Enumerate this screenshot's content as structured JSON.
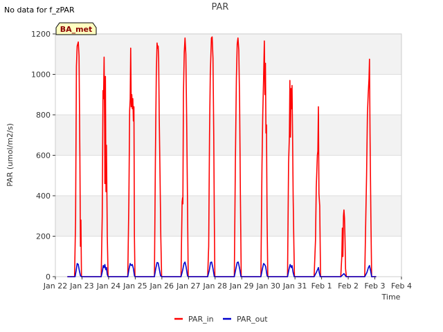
{
  "chart_data": {
    "type": "line",
    "title": "PAR",
    "note": "No data for f_zPAR",
    "badge": "BA_met",
    "xlabel": "Time",
    "ylabel": "PAR (umol/m2/s)",
    "xlim": [
      0,
      13
    ],
    "ylim": [
      0,
      1200
    ],
    "x_tick_labels": [
      "Jan 22",
      "Jan 23",
      "Jan 24",
      "Jan 25",
      "Jan 26",
      "Jan 27",
      "Jan 28",
      "Jan 29",
      "Jan 30",
      "Jan 31",
      "Feb 1",
      "Feb 2",
      "Feb 3",
      "Feb 4"
    ],
    "y_ticks": [
      0,
      200,
      400,
      600,
      800,
      1000,
      1200
    ],
    "x_unit_note": "x values are days, with day 0 = Jan 22 00:00",
    "grid": true,
    "legend_position": "bottom",
    "series": [
      {
        "name": "PAR_in",
        "color": "#ff0000",
        "points": [
          [
            0.45,
            0
          ],
          [
            0.72,
            0
          ],
          [
            0.76,
            280
          ],
          [
            0.79,
            1040
          ],
          [
            0.82,
            1140
          ],
          [
            0.86,
            1160
          ],
          [
            0.89,
            1090
          ],
          [
            0.92,
            600
          ],
          [
            0.94,
            150
          ],
          [
            0.96,
            280
          ],
          [
            0.98,
            0
          ],
          [
            1.72,
            0
          ],
          [
            1.76,
            300
          ],
          [
            1.79,
            920
          ],
          [
            1.81,
            880
          ],
          [
            1.83,
            1085
          ],
          [
            1.85,
            740
          ],
          [
            1.86,
            460
          ],
          [
            1.88,
            990
          ],
          [
            1.9,
            420
          ],
          [
            1.92,
            650
          ],
          [
            1.95,
            200
          ],
          [
            1.98,
            0
          ],
          [
            2.72,
            0
          ],
          [
            2.76,
            380
          ],
          [
            2.79,
            820
          ],
          [
            2.81,
            880
          ],
          [
            2.83,
            1130
          ],
          [
            2.85,
            840
          ],
          [
            2.87,
            900
          ],
          [
            2.89,
            830
          ],
          [
            2.91,
            880
          ],
          [
            2.93,
            770
          ],
          [
            2.95,
            840
          ],
          [
            2.97,
            200
          ],
          [
            2.99,
            0
          ],
          [
            3.72,
            0
          ],
          [
            3.76,
            620
          ],
          [
            3.79,
            1000
          ],
          [
            3.82,
            1155
          ],
          [
            3.84,
            1130
          ],
          [
            3.86,
            1140
          ],
          [
            3.88,
            1080
          ],
          [
            3.9,
            800
          ],
          [
            3.93,
            500
          ],
          [
            3.96,
            200
          ],
          [
            3.99,
            0
          ],
          [
            4.72,
            0
          ],
          [
            4.76,
            370
          ],
          [
            4.78,
            390
          ],
          [
            4.79,
            360
          ],
          [
            4.81,
            900
          ],
          [
            4.84,
            1110
          ],
          [
            4.87,
            1180
          ],
          [
            4.9,
            1100
          ],
          [
            4.93,
            800
          ],
          [
            4.96,
            400
          ],
          [
            4.99,
            0
          ],
          [
            5.72,
            0
          ],
          [
            5.76,
            150
          ],
          [
            5.79,
            700
          ],
          [
            5.82,
            1000
          ],
          [
            5.86,
            1180
          ],
          [
            5.89,
            1185
          ],
          [
            5.92,
            1080
          ],
          [
            5.95,
            700
          ],
          [
            5.97,
            300
          ],
          [
            5.99,
            0
          ],
          [
            6.72,
            0
          ],
          [
            6.76,
            550
          ],
          [
            6.8,
            980
          ],
          [
            6.83,
            1150
          ],
          [
            6.86,
            1180
          ],
          [
            6.89,
            1120
          ],
          [
            6.92,
            850
          ],
          [
            6.95,
            400
          ],
          [
            6.98,
            0
          ],
          [
            7.72,
            0
          ],
          [
            7.76,
            550
          ],
          [
            7.79,
            800
          ],
          [
            7.82,
            980
          ],
          [
            7.85,
            1165
          ],
          [
            7.87,
            900
          ],
          [
            7.89,
            1055
          ],
          [
            7.91,
            710
          ],
          [
            7.93,
            750
          ],
          [
            7.95,
            300
          ],
          [
            7.98,
            0
          ],
          [
            8.72,
            0
          ],
          [
            8.76,
            560
          ],
          [
            8.79,
            700
          ],
          [
            8.81,
            970
          ],
          [
            8.83,
            690
          ],
          [
            8.85,
            930
          ],
          [
            8.87,
            830
          ],
          [
            8.89,
            945
          ],
          [
            8.91,
            700
          ],
          [
            8.93,
            400
          ],
          [
            8.96,
            150
          ],
          [
            8.98,
            0
          ],
          [
            9.72,
            0
          ],
          [
            9.77,
            180
          ],
          [
            9.8,
            440
          ],
          [
            9.84,
            600
          ],
          [
            9.86,
            620
          ],
          [
            9.88,
            840
          ],
          [
            9.9,
            410
          ],
          [
            9.93,
            350
          ],
          [
            9.96,
            0
          ],
          [
            10.72,
            0
          ],
          [
            10.76,
            100
          ],
          [
            10.78,
            240
          ],
          [
            10.8,
            100
          ],
          [
            10.82,
            300
          ],
          [
            10.84,
            330
          ],
          [
            10.86,
            290
          ],
          [
            10.88,
            180
          ],
          [
            10.9,
            40
          ],
          [
            10.93,
            0
          ],
          [
            11.62,
            0
          ],
          [
            11.66,
            300
          ],
          [
            11.69,
            500
          ],
          [
            11.72,
            800
          ],
          [
            11.75,
            900
          ],
          [
            11.78,
            980
          ],
          [
            11.8,
            1075
          ],
          [
            11.82,
            700
          ],
          [
            11.85,
            300
          ],
          [
            11.88,
            0
          ],
          [
            12.05,
            0
          ]
        ]
      },
      {
        "name": "PAR_out",
        "color": "#0000cc",
        "points": [
          [
            0.45,
            0
          ],
          [
            0.74,
            0
          ],
          [
            0.78,
            30
          ],
          [
            0.82,
            65
          ],
          [
            0.86,
            60
          ],
          [
            0.9,
            30
          ],
          [
            0.94,
            5
          ],
          [
            0.98,
            0
          ],
          [
            1.72,
            0
          ],
          [
            1.77,
            30
          ],
          [
            1.8,
            55
          ],
          [
            1.83,
            45
          ],
          [
            1.86,
            60
          ],
          [
            1.89,
            35
          ],
          [
            1.92,
            45
          ],
          [
            1.95,
            10
          ],
          [
            1.98,
            0
          ],
          [
            2.72,
            0
          ],
          [
            2.77,
            40
          ],
          [
            2.81,
            65
          ],
          [
            2.85,
            55
          ],
          [
            2.89,
            60
          ],
          [
            2.93,
            40
          ],
          [
            2.97,
            5
          ],
          [
            2.99,
            0
          ],
          [
            3.72,
            0
          ],
          [
            3.77,
            40
          ],
          [
            3.82,
            70
          ],
          [
            3.86,
            68
          ],
          [
            3.9,
            40
          ],
          [
            3.95,
            5
          ],
          [
            3.99,
            0
          ],
          [
            4.72,
            0
          ],
          [
            4.78,
            30
          ],
          [
            4.83,
            65
          ],
          [
            4.87,
            72
          ],
          [
            4.91,
            50
          ],
          [
            4.96,
            5
          ],
          [
            4.99,
            0
          ],
          [
            5.72,
            0
          ],
          [
            5.78,
            30
          ],
          [
            5.83,
            70
          ],
          [
            5.87,
            72
          ],
          [
            5.92,
            40
          ],
          [
            5.97,
            0
          ],
          [
            6.72,
            0
          ],
          [
            6.78,
            40
          ],
          [
            6.83,
            70
          ],
          [
            6.87,
            72
          ],
          [
            6.92,
            40
          ],
          [
            6.97,
            0
          ],
          [
            7.72,
            0
          ],
          [
            7.78,
            40
          ],
          [
            7.82,
            65
          ],
          [
            7.86,
            60
          ],
          [
            7.9,
            50
          ],
          [
            7.95,
            5
          ],
          [
            7.98,
            0
          ],
          [
            8.72,
            0
          ],
          [
            8.78,
            40
          ],
          [
            8.82,
            60
          ],
          [
            8.86,
            45
          ],
          [
            8.89,
            55
          ],
          [
            8.93,
            20
          ],
          [
            8.97,
            0
          ],
          [
            9.72,
            0
          ],
          [
            9.8,
            20
          ],
          [
            9.85,
            35
          ],
          [
            9.88,
            45
          ],
          [
            9.91,
            20
          ],
          [
            9.95,
            0
          ],
          [
            10.72,
            0
          ],
          [
            10.8,
            10
          ],
          [
            10.84,
            15
          ],
          [
            10.88,
            8
          ],
          [
            10.92,
            0
          ],
          [
            11.62,
            0
          ],
          [
            11.7,
            20
          ],
          [
            11.76,
            45
          ],
          [
            11.8,
            55
          ],
          [
            11.84,
            30
          ],
          [
            11.88,
            0
          ],
          [
            12.05,
            0
          ]
        ]
      }
    ]
  }
}
